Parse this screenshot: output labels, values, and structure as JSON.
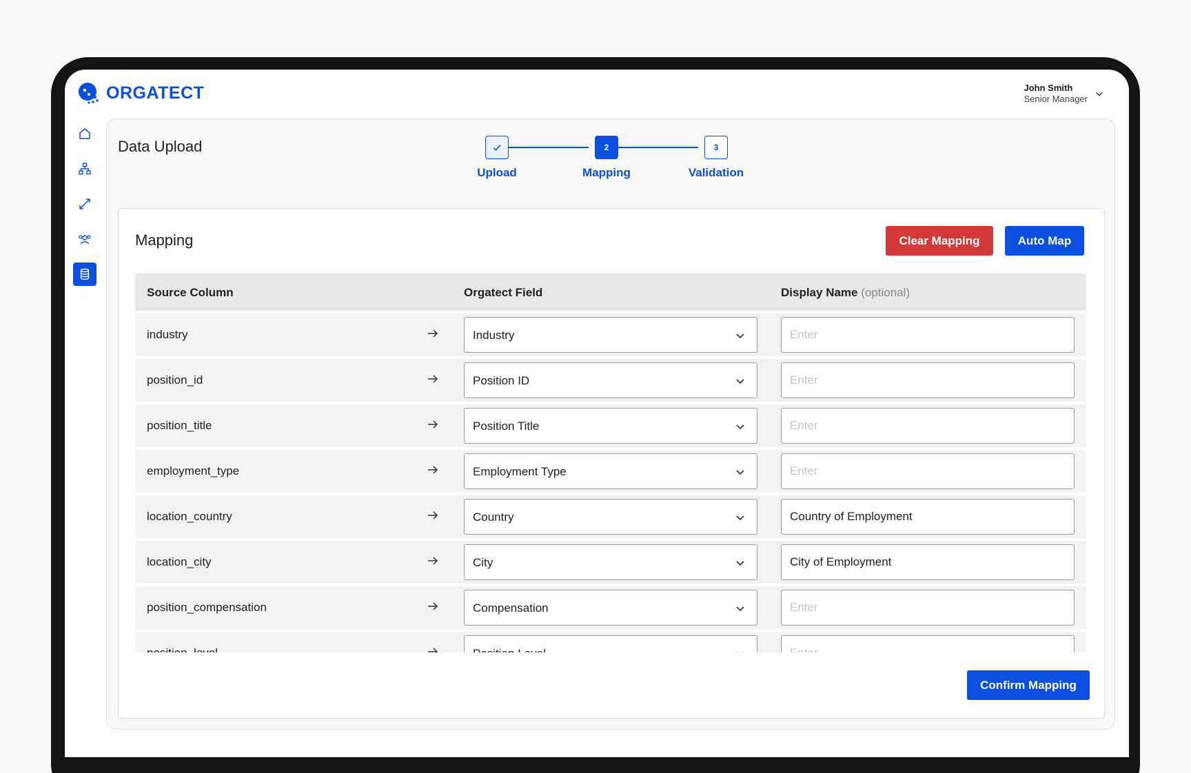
{
  "app": {
    "brand": "ORGATECT"
  },
  "user": {
    "name": "John Smith",
    "role": "Senior Manager"
  },
  "sidebar": {
    "items": [
      {
        "icon": "home-icon",
        "active": false
      },
      {
        "icon": "org-chart-icon",
        "active": false
      },
      {
        "icon": "transfer-icon",
        "active": false
      },
      {
        "icon": "people-icon",
        "active": false
      },
      {
        "icon": "database-icon",
        "active": true
      }
    ]
  },
  "page": {
    "title": "Data Upload"
  },
  "stepper": {
    "steps": [
      {
        "number": "",
        "label": "Upload",
        "state": "done"
      },
      {
        "number": "2",
        "label": "Mapping",
        "state": "current"
      },
      {
        "number": "3",
        "label": "Validation",
        "state": "todo"
      }
    ]
  },
  "mapping": {
    "title": "Mapping",
    "clear_label": "Clear Mapping",
    "auto_label": "Auto Map",
    "confirm_label": "Confirm Mapping",
    "headers": {
      "source": "Source Column",
      "field": "Orgatect Field",
      "display": "Display Name",
      "display_optional": "(optional)"
    },
    "placeholder": "Enter",
    "rows": [
      {
        "source": "industry",
        "field": "Industry",
        "display": ""
      },
      {
        "source": "position_id",
        "field": "Position ID",
        "display": ""
      },
      {
        "source": "position_title",
        "field": "Position Title",
        "display": ""
      },
      {
        "source": "employment_type",
        "field": "Employment Type",
        "display": ""
      },
      {
        "source": "location_country",
        "field": "Country",
        "display": "Country of Employment"
      },
      {
        "source": "location_city",
        "field": "City",
        "display": "City of Employment"
      },
      {
        "source": "position_compensation",
        "field": "Compensation",
        "display": ""
      },
      {
        "source": "position_level",
        "field": "Position Level",
        "display": ""
      }
    ]
  },
  "colors": {
    "accent": "#0a4fe0",
    "danger": "#d43a3a"
  }
}
